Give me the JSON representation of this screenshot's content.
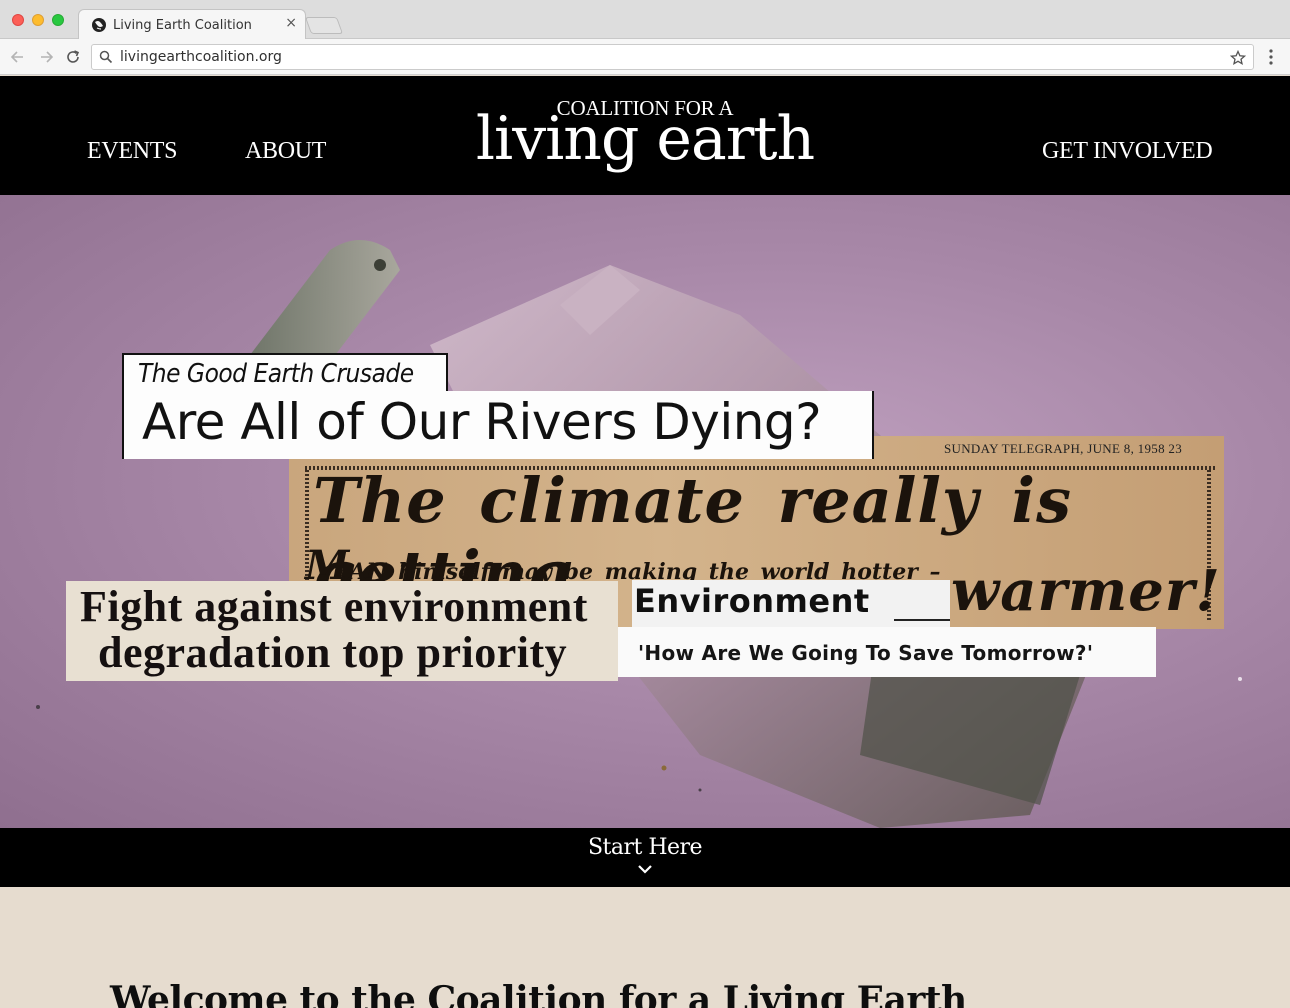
{
  "browser": {
    "tab_title": "Living Earth Coalition",
    "tab_close": "×",
    "url": "livingearthcoalition.org"
  },
  "header": {
    "nav_left": [
      "EVENTS",
      "ABOUT"
    ],
    "nav_right": "GET INVOLVED",
    "logo_small": "COALITION FOR A",
    "logo_large": "living earth"
  },
  "hero": {
    "clippings": {
      "crusade": "The Good Earth Crusade",
      "rivers": "Are All of Our Rivers Dying?",
      "telegraph_meta": "SUNDAY  TELEGRAPH,  JUNE  8,  1958     23",
      "telegraph_headline": "The climate really is getting",
      "telegraph_sub_initial": "M",
      "telegraph_sub": "AN himself may be making the world hotter –",
      "telegraph_warmer": "warmer!",
      "fight_line1": "Fight against environment",
      "fight_line2": "degradation top priority",
      "environment": "Environment",
      "tomorrow": "'How Are We Going To Save Tomorrow?'"
    }
  },
  "start": {
    "label": "Start Here"
  },
  "welcome": {
    "title": "Welcome to the Coalition for a Living Earth"
  },
  "colors": {
    "header_bg": "#000000",
    "hero_tint": "#a888a8",
    "page_bg": "#e6dccf"
  },
  "icons": [
    "earth-favicon-icon",
    "back-arrow-icon",
    "forward-arrow-icon",
    "reload-icon",
    "search-icon",
    "star-icon",
    "menu-dots-icon",
    "chevron-down-icon"
  ]
}
